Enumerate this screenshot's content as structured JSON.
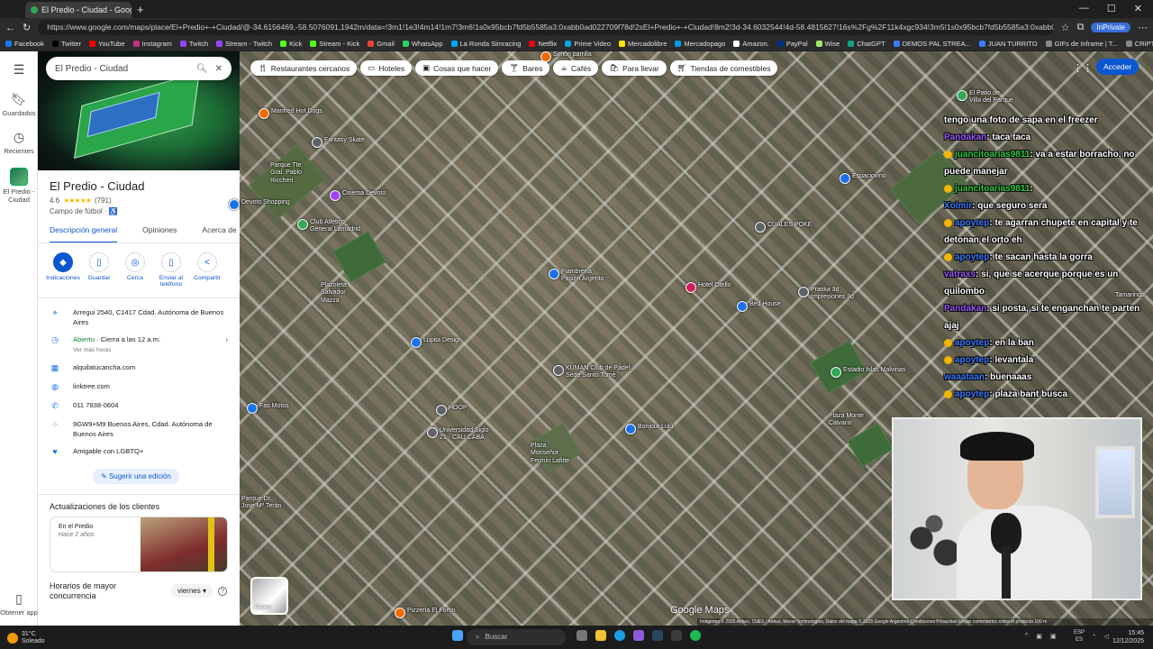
{
  "browser": {
    "tab_title": "El Predio - Ciudad - Google Maps",
    "url": "https://www.google.com/maps/place/El+Predio+-+Ciudad/@-34.6156469,-58.5076091,1942m/data=!3m1!1e3!4m14!1m7!3m6!1s0x95bcb7fd5b5585a3:0xabb0ad022709f78d!2sEl+Predio+-+Ciudad!8m2!3d-34.6032544!4d-58.4815627!16s%2Fg%2F11k4xgc934!3m5!1s0x95bcb7fd5b5585a3:0xabb0ad022709f78d!8m2!3d-34.6032544!4d-58.481562",
    "inprivate": "InPrivate",
    "bookmarks": [
      "Facebook",
      "Twitter",
      "YouTube",
      "Instagram",
      "Twitch",
      "Stream - Twitch",
      "Kick",
      "Stream - Kick",
      "Gmail",
      "WhatsApp",
      "La Ronda Simracing",
      "Netflix",
      "Prime Video",
      "Mercadolibre",
      "Mercadopago",
      "Amazon.",
      "PayPal",
      "Wise",
      "ChatGPT",
      "DEMOS PAL STREA...",
      "JUAN TURRITO",
      "GIFs de Inframe | T...",
      "CRIPTO",
      "aires"
    ]
  },
  "rail": {
    "menu_icon": "menu-icon",
    "saved": "Guardados",
    "recent": "Recientes",
    "place": "El Predio - Ciudad",
    "get_app": "Obtener app"
  },
  "search": {
    "value": "El Predio - Ciudad"
  },
  "place": {
    "title": "El Predio - Ciudad",
    "rating": "4.6",
    "stars": "★★★★★",
    "reviews": "(791)",
    "category": "Campo de fútbol · ♿",
    "tabs": [
      "Descripción general",
      "Opiniones",
      "Acerca de"
    ],
    "actions": [
      "Indicaciones",
      "Guardar",
      "Cerca",
      "Enviar al teléfono",
      "Compartir"
    ],
    "address": "Arregui 2540, C1417 Cdad. Autónoma de Buenos Aires",
    "open_status": "Abierto",
    "open_detail": " · Cierra a las 12 a.m.",
    "hours_link": "Ver más horas",
    "website1": "alquilatucancha.com",
    "website2": "linktree.com",
    "phone": "011 7838-0604",
    "plus_code": "9GW9+M9 Buenos Aires, Cdad. Autónoma de Buenos Aires",
    "lgbtq": "Amigable con LGBTQ+",
    "suggest": "Sugerir una edición",
    "updates_title": "Actualizaciones de los clientes",
    "update_card_title": "En el Predio",
    "update_card_time": "Hace 2 años",
    "hours_title": "Horarios de mayor concurrencia",
    "day": "viernes"
  },
  "map": {
    "chips": [
      "Restaurantes cercanos",
      "Hoteles",
      "Cosas que hacer",
      "Bares",
      "Cafés",
      "Para llevar",
      "Tiendas de comestibles"
    ],
    "signin": "Acceder",
    "layers": "Capas",
    "brand": "Google Maps",
    "attribution": "Imágenes © 2025 Airbus, CNES / Airbus, Maxar Technologies, Datos del mapa © 2025 Google   Argentina   Condiciones   Privacidad   Enviar comentarios sobre el producto   100 m",
    "labels": {
      "manfred": "Manfred Hot Dogs",
      "fantasy": "Fantasy Skate",
      "cinema": "Cinema Devoto",
      "parque": "Parque Tte.\nGral. Pablo\nRiccheri",
      "devoto": "Devoto Shopping",
      "lamadrid": "Club Atlético\nGeneral Lamadrid",
      "plazoleta": "Plazoleta\nSalvador\nMazza",
      "lupita": "Lupita Design",
      "fiambreria": "Fiambrería\nPasión Argento",
      "otello": "Hotel Otello",
      "pratika": "Pratika 3d\nImpresiones 3d",
      "bedhouse": "Bed House",
      "cuales": "CUALES POKE",
      "kuman": "KUMAN Club de Pádel\nSede Santo Tomé",
      "malvinas": "Estadio Islas Malvinas",
      "hoop": "HOOP",
      "universidad": "Universidad Siglo\n21 - CAU CABA",
      "plaza": "Plaza\nMonseñor\nFermín Lafitte",
      "bonjour": "Bonjour Lulú",
      "montecal": "Plaza Monte\nCalvario",
      "fasmotos": "Fas Motos",
      "simon": "Simón parrilla",
      "pizzeria": "Pizzería El Fortín",
      "espaciovino": "Espaciovino",
      "patio": "El Patio de\nVilla del Parque",
      "tamarindo": "Tamarindo",
      "terreros": "Parque Dr.\nJose Mª Terán"
    }
  },
  "chat": [
    {
      "user": "",
      "text": "tengo una foto de sapa en el freezer",
      "color": "#ffffff",
      "badge": false
    },
    {
      "user": "Pandakan",
      "text": ": taca taca",
      "color": "#9b59ff",
      "badge": false
    },
    {
      "user": "juancitoarias9811",
      "text": ": va a estar borracho, no puede manejar",
      "color": "#2ecc40",
      "badge": true
    },
    {
      "user": "juancitoarias9811",
      "text": ":",
      "color": "#2ecc40",
      "badge": true
    },
    {
      "user": "Xolmir",
      "text": ": que seguro sera",
      "color": "#3b7bff",
      "badge": false
    },
    {
      "user": "apoytep",
      "text": ": te agarran chupete en capital y te detonan el orto eh",
      "color": "#3b7bff",
      "badge": true
    },
    {
      "user": "apoytep",
      "text": ": te sacan hasta la gorra",
      "color": "#3b7bff",
      "badge": true
    },
    {
      "user": "vatraxs",
      "text": ": si, que se acerque porque es un quilombo",
      "color": "#9b59ff",
      "badge": false
    },
    {
      "user": "Pandakan",
      "text": ": si posta, si te enganchan te parten ajaj",
      "color": "#9b59ff",
      "badge": false
    },
    {
      "user": "apoytep",
      "text": ": en la ban",
      "color": "#3b7bff",
      "badge": true
    },
    {
      "user": "apoytep",
      "text": ": levantala",
      "color": "#3b7bff",
      "badge": true
    },
    {
      "user": "waaataan",
      "text": ": buenaaas",
      "color": "#3b7bff",
      "badge": false
    },
    {
      "user": "apoytep",
      "text": ": plaza bant busca",
      "color": "#3b7bff",
      "badge": true
    }
  ],
  "taskbar": {
    "temp": "31°C",
    "weather": "Soleado",
    "search": "Buscar",
    "lang1": "ESP",
    "lang2": "ES",
    "time": "15:45",
    "date": "12/12/2025"
  }
}
